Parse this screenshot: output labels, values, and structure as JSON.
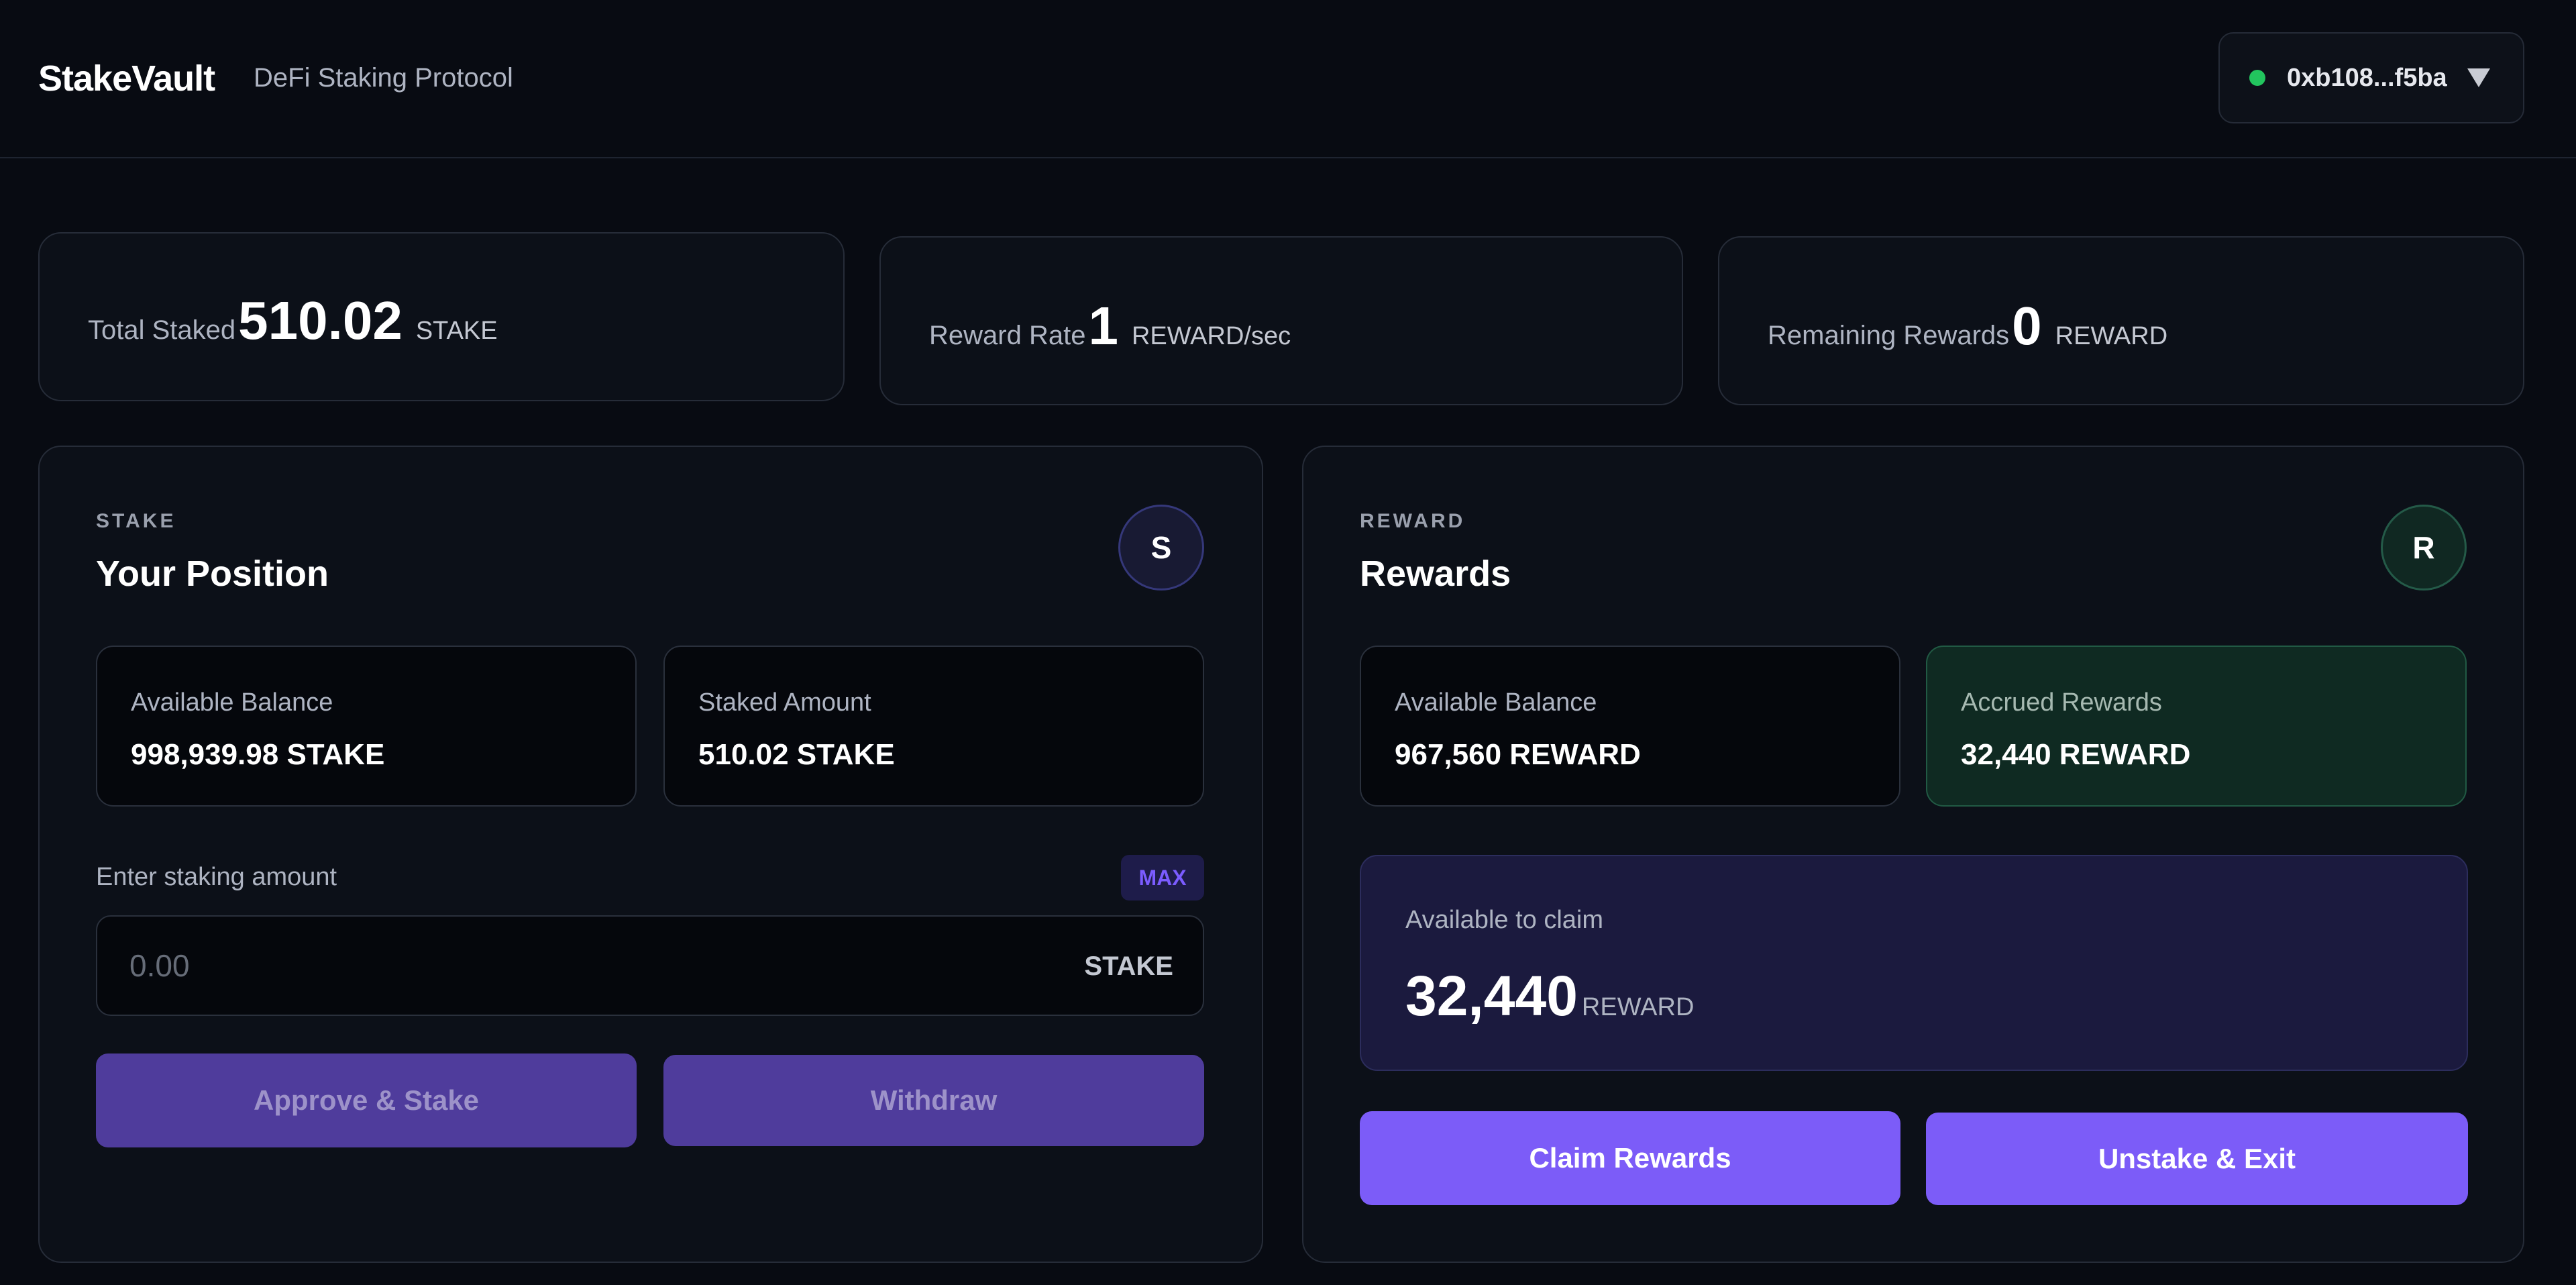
{
  "header": {
    "brand": "StakeVault",
    "tagline": "DeFi Staking Protocol",
    "wallet_address": "0xb108...f5ba",
    "wallet_status_color": "#22c55e"
  },
  "stats": [
    {
      "label": "Total Staked",
      "value": "510.02",
      "unit": "STAKE"
    },
    {
      "label": "Reward Rate",
      "value": "1",
      "unit": "REWARD/sec"
    },
    {
      "label": "Remaining Rewards",
      "value": "0",
      "unit": "REWARD"
    }
  ],
  "stake_panel": {
    "tag": "STAKE",
    "title": "Your Position",
    "badge": "S",
    "available_balance_label": "Available Balance",
    "available_balance_value": "998,939.98 STAKE",
    "staked_amount_label": "Staked Amount",
    "staked_amount_value": "510.02 STAKE",
    "input_label": "Enter staking amount",
    "max_label": "MAX",
    "input_placeholder": "0.00",
    "input_unit": "STAKE",
    "approve_button": "Approve & Stake",
    "withdraw_button": "Withdraw"
  },
  "reward_panel": {
    "tag": "REWARD",
    "title": "Rewards",
    "badge": "R",
    "available_balance_label": "Available Balance",
    "available_balance_value": "967,560 REWARD",
    "accrued_label": "Accrued Rewards",
    "accrued_value": "32,440 REWARD",
    "claim_label": "Available to claim",
    "claim_value": "32,440",
    "claim_unit": "REWARD",
    "claim_button": "Claim Rewards",
    "exit_button": "Unstake & Exit"
  },
  "colors": {
    "background": "#080b12",
    "accent": "#7c5cf8",
    "accent_disabled": "#4f3c9c",
    "accrued_bg": "#0f2a22"
  }
}
